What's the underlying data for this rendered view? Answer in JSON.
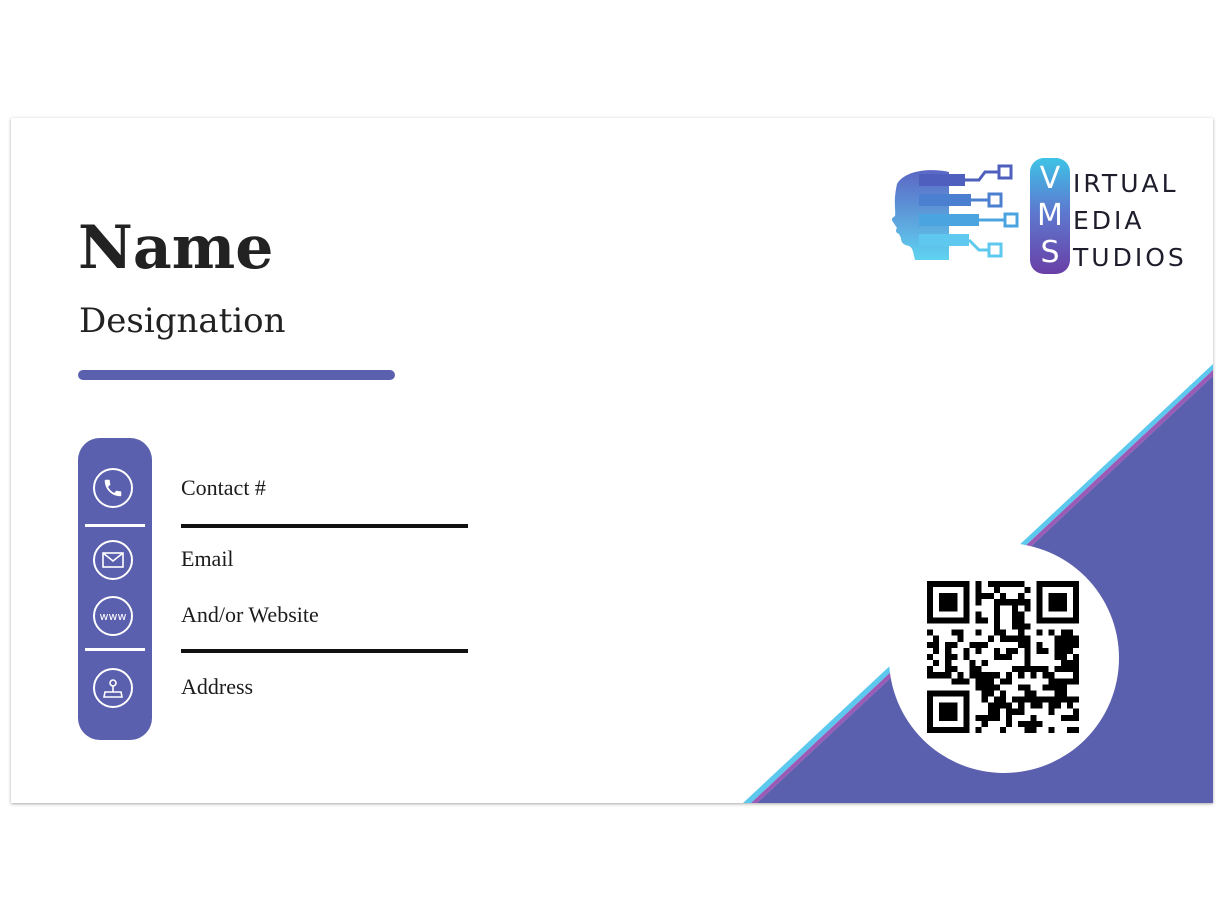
{
  "card": {
    "name": "Name",
    "designation": "Designation",
    "fields": [
      {
        "label": "Contact #",
        "icon": "phone-icon"
      },
      {
        "label": "Email",
        "icon": "envelope-icon"
      },
      {
        "label": "And/or Website",
        "icon": "www-icon",
        "icon_text": "www"
      },
      {
        "label": "Address",
        "icon": "map-pin-icon"
      }
    ]
  },
  "logo": {
    "letters": [
      "V",
      "M",
      "S"
    ],
    "words": [
      "IRTUAL",
      "EDIA",
      "TUDIOS"
    ]
  },
  "colors": {
    "accent": "#5a5fae",
    "stripe_light_blue": "#5cc8ee",
    "stripe_purple": "#9a5bb6",
    "text": "#222222"
  },
  "qr": {
    "icon": "qr-code"
  }
}
